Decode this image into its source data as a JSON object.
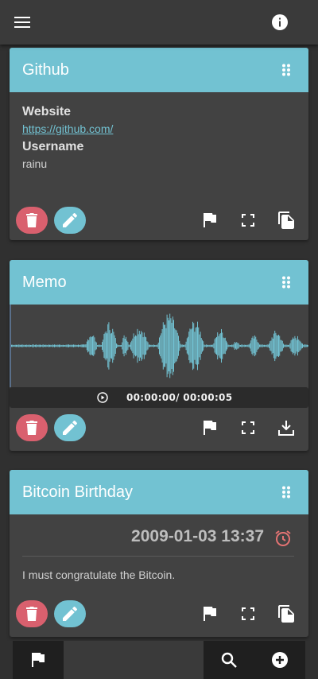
{
  "topbar": {
    "menu_icon": "menu-icon",
    "info_icon": "info-icon"
  },
  "cards": [
    {
      "title": "Github",
      "fields": [
        {
          "label": "Website",
          "value": "https://github.com/",
          "is_link": true
        },
        {
          "label": "Username",
          "value": "rainu",
          "is_link": false
        }
      ],
      "actions": [
        "delete-icon",
        "edit-icon",
        "flag-icon",
        "fullscreen-icon",
        "copy-icon"
      ]
    },
    {
      "title": "Memo",
      "player": {
        "time": "00:00:00/ 00:00:05"
      },
      "actions": [
        "delete-icon",
        "edit-icon",
        "flag-icon",
        "fullscreen-icon",
        "download-icon"
      ]
    },
    {
      "title": "Bitcoin Birthday",
      "date": "2009-01-03 13:37",
      "note": "I must congratulate the Bitcoin.",
      "actions": [
        "delete-icon",
        "edit-icon",
        "flag-icon",
        "fullscreen-icon",
        "copy-icon"
      ]
    }
  ],
  "bottombar": {
    "icons": [
      "flag-icon",
      "search-icon",
      "add-circle-icon"
    ]
  },
  "colors": {
    "accent": "#72c2d2",
    "danger": "#d9606e",
    "alarm": "#e57373",
    "background": "#303030",
    "card": "#424242"
  }
}
